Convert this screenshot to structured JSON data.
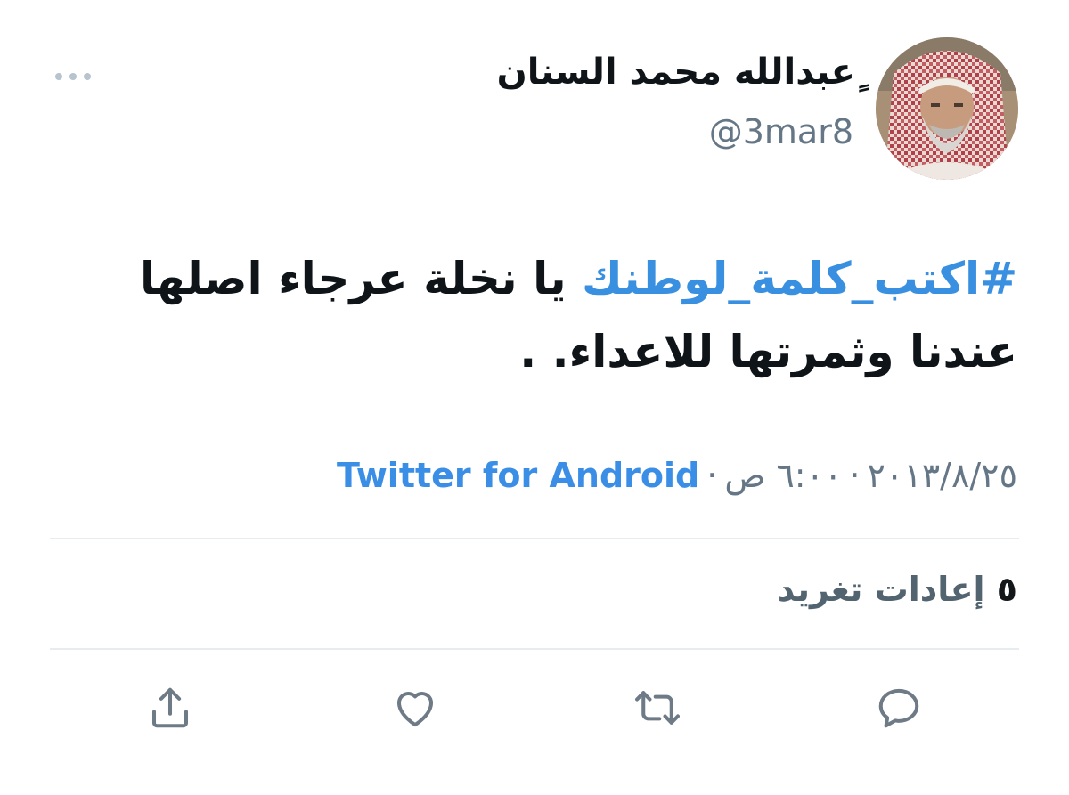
{
  "tweet": {
    "author": {
      "display_name": "ٍعبدالله محمد السنان",
      "handle": "@3mar8"
    },
    "text": {
      "hashtag": "#اكتب_كلمة_لوطنك",
      "body": " يا نخلة عرجاء اصلها عندنا وثمرتها للاعداء. ."
    },
    "meta": {
      "date": "٢٠١٣/٨/٢٥",
      "time": "٦:٠٠ ص",
      "separator": "·",
      "source": "Twitter for Android"
    },
    "stats": {
      "retweets_count": "٥",
      "retweets_label": "إعادات تغريد"
    }
  },
  "icons": {
    "more": "more-options-icon",
    "reply": "reply-icon",
    "retweet": "retweet-icon",
    "like": "like-icon",
    "share": "share-icon"
  },
  "colors": {
    "accent": "#3a8ee6",
    "muted": "#657786",
    "icon": "#6e7b87",
    "divider": "#e6ecf0"
  }
}
